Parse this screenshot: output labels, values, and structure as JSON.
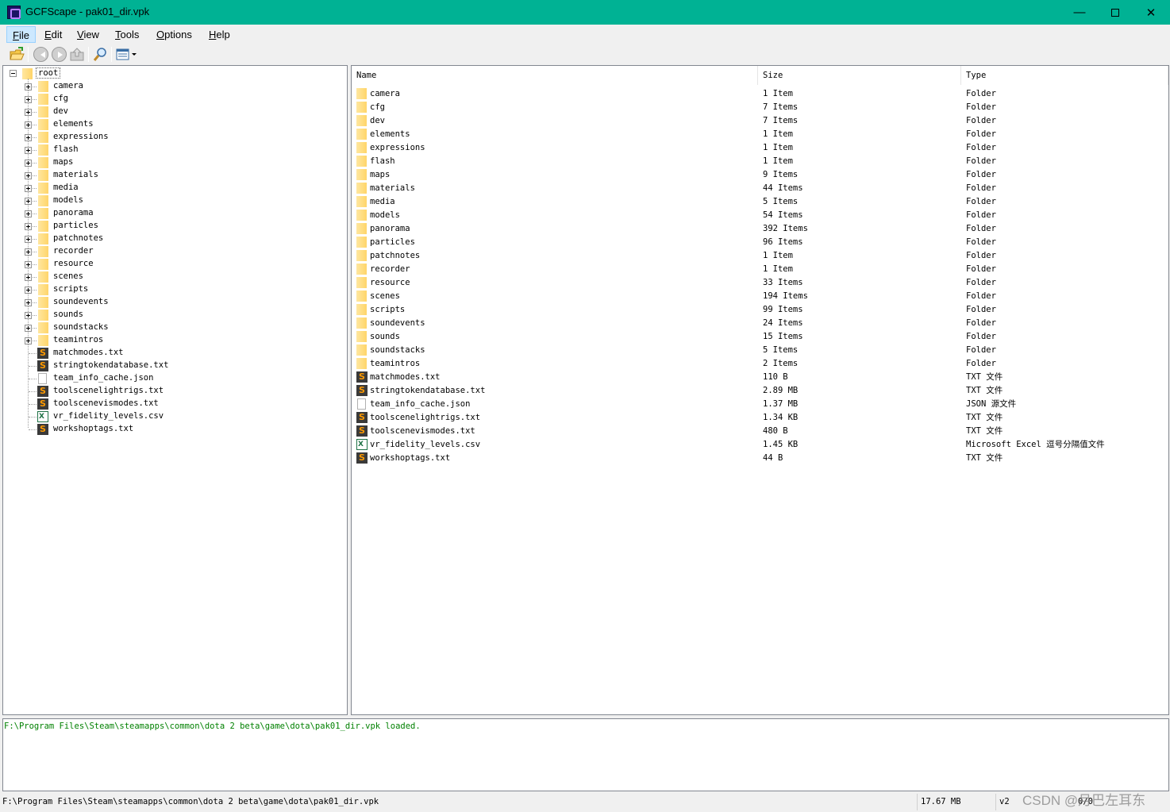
{
  "window": {
    "title": "GCFScape - pak01_dir.vpk"
  },
  "menu": [
    {
      "label": "File",
      "key": "F",
      "rest": "ile"
    },
    {
      "label": "Edit",
      "key": "E",
      "rest": "dit"
    },
    {
      "label": "View",
      "key": "V",
      "rest": "iew"
    },
    {
      "label": "Tools",
      "key": "T",
      "rest": "ools"
    },
    {
      "label": "Options",
      "key": "O",
      "rest": "ptions"
    },
    {
      "label": "Help",
      "key": "H",
      "rest": "elp"
    }
  ],
  "tree": {
    "root": "root",
    "folders": [
      "camera",
      "cfg",
      "dev",
      "elements",
      "expressions",
      "flash",
      "maps",
      "materials",
      "media",
      "models",
      "panorama",
      "particles",
      "patchnotes",
      "recorder",
      "resource",
      "scenes",
      "scripts",
      "soundevents",
      "sounds",
      "soundstacks",
      "teamintros"
    ],
    "files": [
      {
        "name": "matchmodes.txt",
        "icon": "sublime-icon"
      },
      {
        "name": "stringtokendatabase.txt",
        "icon": "sublime-icon"
      },
      {
        "name": "team_info_cache.json",
        "icon": "document-icon"
      },
      {
        "name": "toolscenelightrigs.txt",
        "icon": "sublime-icon"
      },
      {
        "name": "toolscenevismodes.txt",
        "icon": "sublime-icon"
      },
      {
        "name": "vr_fidelity_levels.csv",
        "icon": "excel-icon"
      },
      {
        "name": "workshoptags.txt",
        "icon": "sublime-icon"
      }
    ]
  },
  "list": {
    "columns": [
      "Name",
      "Size",
      "Type"
    ],
    "rows": [
      {
        "name": "camera",
        "size": "1 Item",
        "type": "Folder",
        "icon": "folder-icon"
      },
      {
        "name": "cfg",
        "size": "7 Items",
        "type": "Folder",
        "icon": "folder-icon"
      },
      {
        "name": "dev",
        "size": "7 Items",
        "type": "Folder",
        "icon": "folder-icon"
      },
      {
        "name": "elements",
        "size": "1 Item",
        "type": "Folder",
        "icon": "folder-icon"
      },
      {
        "name": "expressions",
        "size": "1 Item",
        "type": "Folder",
        "icon": "folder-icon"
      },
      {
        "name": "flash",
        "size": "1 Item",
        "type": "Folder",
        "icon": "folder-icon"
      },
      {
        "name": "maps",
        "size": "9 Items",
        "type": "Folder",
        "icon": "folder-icon"
      },
      {
        "name": "materials",
        "size": "44 Items",
        "type": "Folder",
        "icon": "folder-icon"
      },
      {
        "name": "media",
        "size": "5 Items",
        "type": "Folder",
        "icon": "folder-icon"
      },
      {
        "name": "models",
        "size": "54 Items",
        "type": "Folder",
        "icon": "folder-icon"
      },
      {
        "name": "panorama",
        "size": "392 Items",
        "type": "Folder",
        "icon": "folder-icon"
      },
      {
        "name": "particles",
        "size": "96 Items",
        "type": "Folder",
        "icon": "folder-icon"
      },
      {
        "name": "patchnotes",
        "size": "1 Item",
        "type": "Folder",
        "icon": "folder-icon"
      },
      {
        "name": "recorder",
        "size": "1 Item",
        "type": "Folder",
        "icon": "folder-icon"
      },
      {
        "name": "resource",
        "size": "33 Items",
        "type": "Folder",
        "icon": "folder-icon"
      },
      {
        "name": "scenes",
        "size": "194 Items",
        "type": "Folder",
        "icon": "folder-icon"
      },
      {
        "name": "scripts",
        "size": "99 Items",
        "type": "Folder",
        "icon": "folder-icon"
      },
      {
        "name": "soundevents",
        "size": "24 Items",
        "type": "Folder",
        "icon": "folder-icon"
      },
      {
        "name": "sounds",
        "size": "15 Items",
        "type": "Folder",
        "icon": "folder-icon"
      },
      {
        "name": "soundstacks",
        "size": "5 Items",
        "type": "Folder",
        "icon": "folder-icon"
      },
      {
        "name": "teamintros",
        "size": "2 Items",
        "type": "Folder",
        "icon": "folder-icon"
      },
      {
        "name": "matchmodes.txt",
        "size": "110 B",
        "type": "TXT 文件",
        "icon": "sublime-icon"
      },
      {
        "name": "stringtokendatabase.txt",
        "size": "2.89 MB",
        "type": "TXT 文件",
        "icon": "sublime-icon"
      },
      {
        "name": "team_info_cache.json",
        "size": "1.37 MB",
        "type": "JSON 源文件",
        "icon": "document-icon"
      },
      {
        "name": "toolscenelightrigs.txt",
        "size": "1.34 KB",
        "type": "TXT 文件",
        "icon": "sublime-icon"
      },
      {
        "name": "toolscenevismodes.txt",
        "size": "480 B",
        "type": "TXT 文件",
        "icon": "sublime-icon"
      },
      {
        "name": "vr_fidelity_levels.csv",
        "size": "1.45 KB",
        "type": "Microsoft Excel 逗号分隔值文件",
        "icon": "excel-icon"
      },
      {
        "name": "workshoptags.txt",
        "size": "44 B",
        "type": "TXT 文件",
        "icon": "sublime-icon"
      }
    ]
  },
  "log": {
    "message": "F:\\Program Files\\Steam\\steamapps\\common\\dota 2 beta\\game\\dota\\pak01_dir.vpk loaded.",
    "color": "#008000"
  },
  "status": {
    "path": "F:\\Program Files\\Steam\\steamapps\\common\\dota 2 beta\\game\\dota\\pak01_dir.vpk",
    "size": "17.67 MB",
    "version": "v2",
    "count": "0/0"
  },
  "watermark": "CSDN @月巴左耳东",
  "colors": {
    "titlebar": "#00b294",
    "folder": "#ffd86b"
  }
}
